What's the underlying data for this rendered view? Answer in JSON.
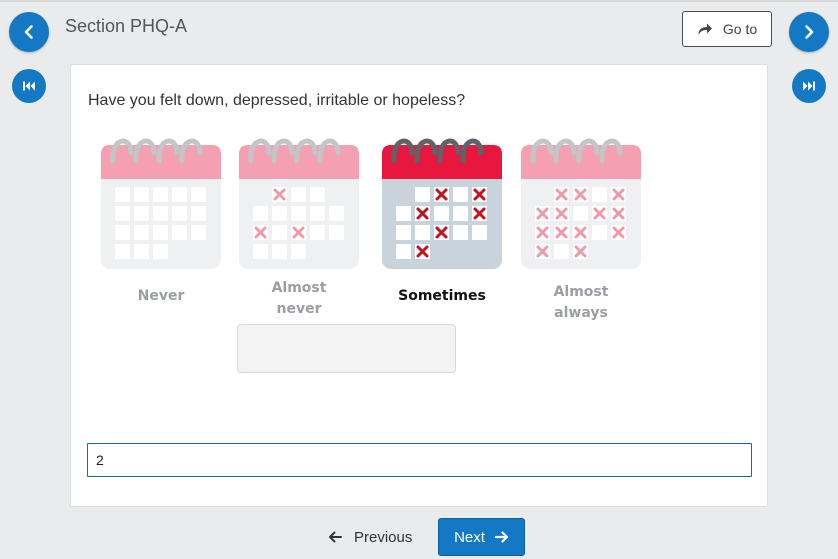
{
  "header": {
    "section_title": "Section PHQ-A",
    "goto_label": "Go to",
    "back_icon": "chevron-left-icon",
    "forward_icon": "chevron-right-icon",
    "first_icon": "skip-first-icon",
    "last_icon": "skip-last-icon"
  },
  "question": {
    "text": "Have you felt down, depressed, irritable or hopeless?",
    "options": [
      {
        "label": "Never",
        "selected": false
      },
      {
        "label": "Almost\nnever",
        "selected": false
      },
      {
        "label": "Sometimes",
        "selected": true
      },
      {
        "label": "Almost\nalways",
        "selected": false
      }
    ]
  },
  "answer": {
    "value": "2"
  },
  "footer": {
    "previous_label": "Previous",
    "next_label": "Next"
  },
  "colors": {
    "accent": "#1479c4",
    "calendar_header": "#f5a0b2",
    "calendar_header_selected": "#e8173f",
    "calendar_body": "#eef0f2",
    "calendar_body_selected": "#c9d3dc",
    "mark": "#ee9aaa",
    "mark_selected": "#c5101e"
  }
}
